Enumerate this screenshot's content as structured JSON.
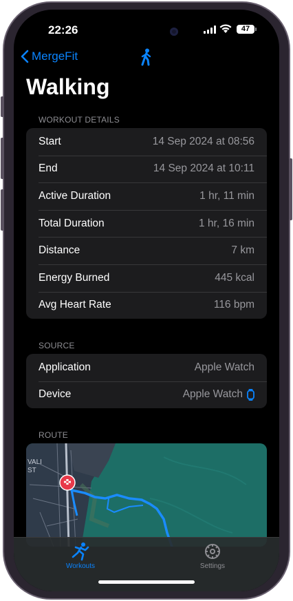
{
  "status_bar": {
    "time": "22:26",
    "battery": "47"
  },
  "nav": {
    "back_label": "MergeFit"
  },
  "title": "Walking",
  "workout_details": {
    "header": "WORKOUT DETAILS",
    "rows": [
      {
        "label": "Start",
        "value": "14 Sep 2024 at 08:56"
      },
      {
        "label": "End",
        "value": "14 Sep 2024 at 10:11"
      },
      {
        "label": "Active Duration",
        "value": "1 hr, 11 min"
      },
      {
        "label": "Total Duration",
        "value": "1 hr, 16 min"
      },
      {
        "label": "Distance",
        "value": "7 km"
      },
      {
        "label": "Energy Burned",
        "value": "445 kcal"
      },
      {
        "label": "Avg Heart Rate",
        "value": "116 bpm"
      }
    ]
  },
  "source": {
    "header": "SOURCE",
    "rows": [
      {
        "label": "Application",
        "value": "Apple Watch"
      },
      {
        "label": "Device",
        "value": "Apple Watch"
      }
    ]
  },
  "route": {
    "header": "ROUTE",
    "map_labels": [
      "VALI",
      "ST"
    ]
  },
  "tabs": [
    {
      "label": "Workouts",
      "icon": "workouts-icon",
      "active": true
    },
    {
      "label": "Settings",
      "icon": "settings-gear-icon",
      "active": false
    }
  ],
  "colors": {
    "accent": "#0a84ff",
    "background": "#000000",
    "group_bg": "#1c1c1e",
    "secondary_text": "#98989d"
  }
}
